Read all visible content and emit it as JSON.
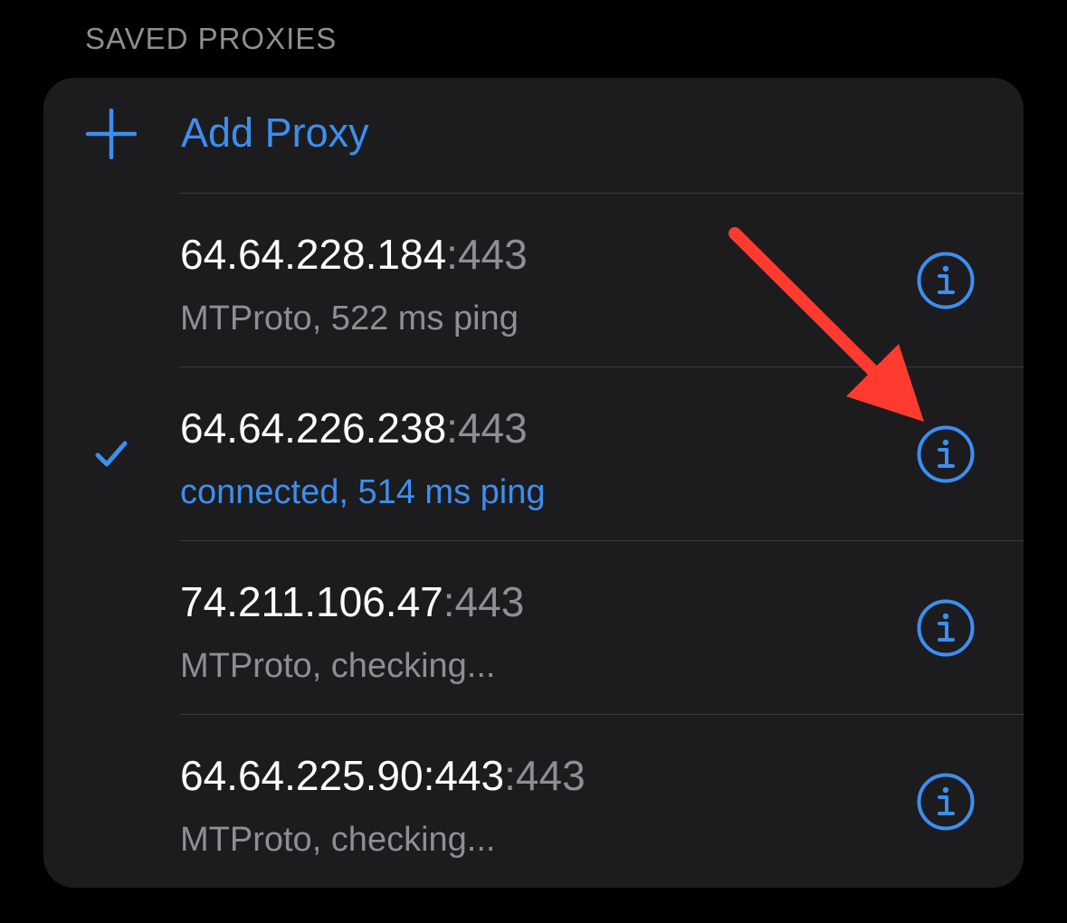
{
  "section": {
    "title": "SAVED PROXIES"
  },
  "add_proxy": {
    "label": "Add Proxy",
    "icon": "plus-icon"
  },
  "proxies": [
    {
      "host": "64.64.228.184",
      "port": ":443",
      "status": "MTProto, 522 ms ping",
      "selected": false
    },
    {
      "host": "64.64.226.238",
      "port": ":443",
      "status": "connected, 514 ms ping",
      "selected": true
    },
    {
      "host": "74.211.106.47",
      "port": ":443",
      "status": "MTProto, checking...",
      "selected": false
    },
    {
      "host": "64.64.225.90:443",
      "port": ":443",
      "status": "MTProto, checking...",
      "selected": false
    }
  ],
  "colors": {
    "accent": "#3d8ef0",
    "background": "#000000",
    "card": "#1c1c1e",
    "secondary_text": "#8e8e93",
    "annotation_arrow": "#ff3b30"
  }
}
